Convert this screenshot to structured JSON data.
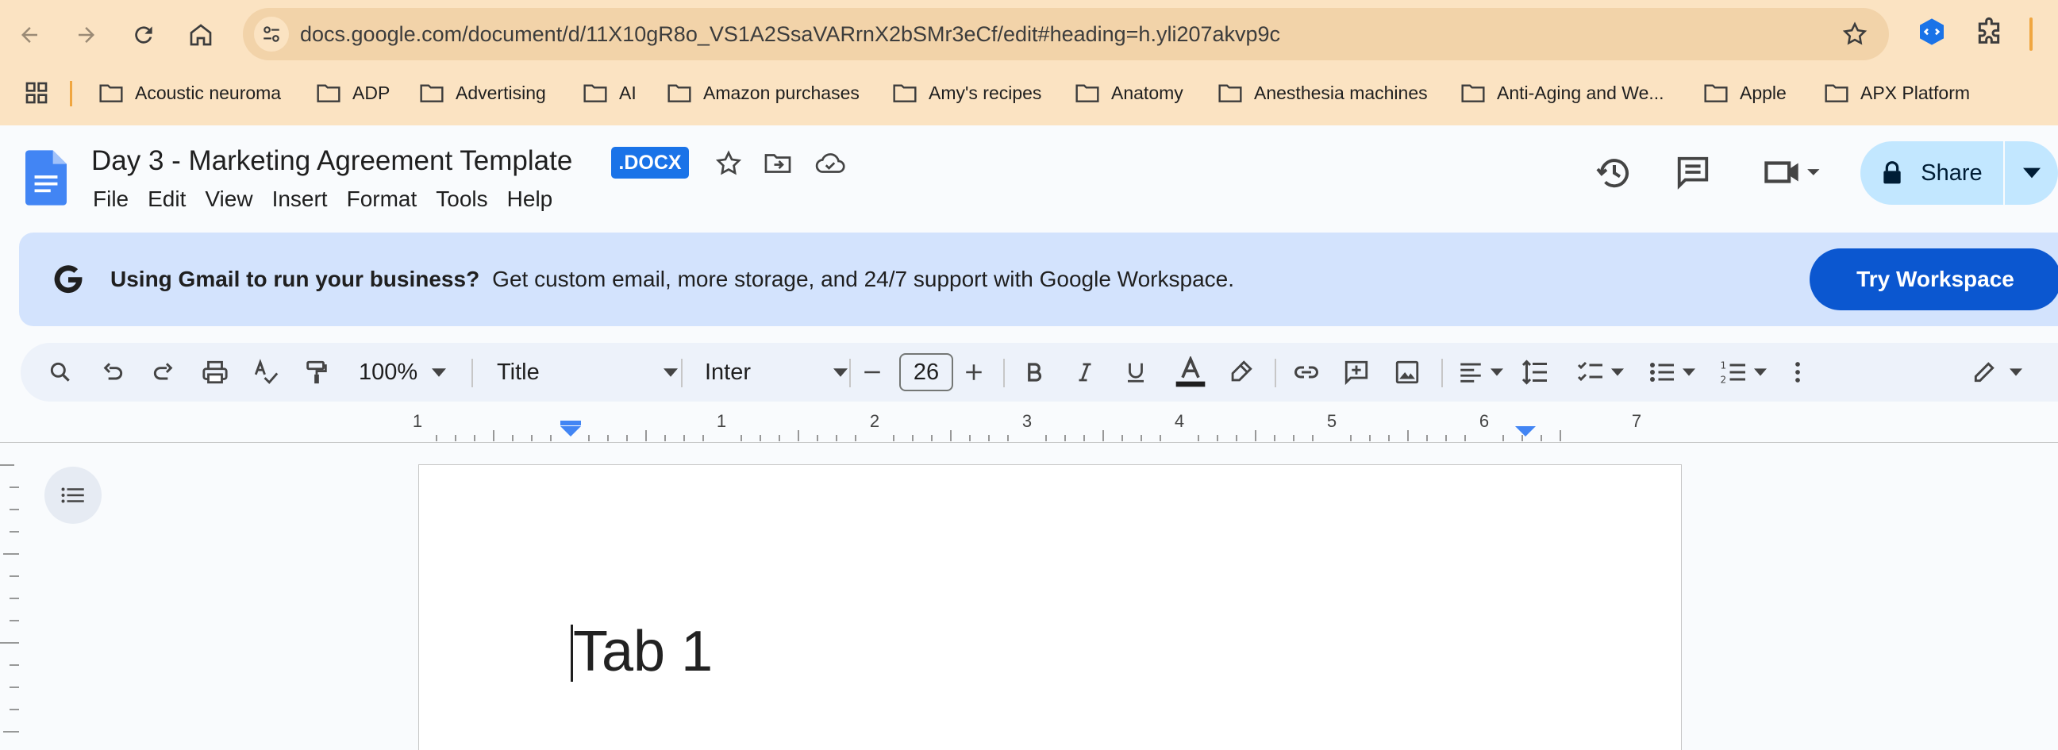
{
  "browser": {
    "url": "docs.google.com/document/d/11X10gR8o_VS1A2SsaVARrnX2bSMr3eCf/edit#heading=h.yli207akvp9c",
    "bookmarks": [
      "Acoustic neuroma",
      "ADP",
      "Advertising",
      "AI",
      "Amazon purchases",
      "Amy's recipes",
      "Anatomy",
      "Anesthesia machines",
      "Anti-Aging and We...",
      "Apple",
      "APX Platform"
    ],
    "accent_color": "#fbe3c2"
  },
  "doc": {
    "title": "Day 3 - Marketing Agreement Template",
    "badge": ".DOCX",
    "menus": [
      "File",
      "Edit",
      "View",
      "Insert",
      "Format",
      "Tools",
      "Help"
    ],
    "share_label": "Share"
  },
  "banner": {
    "headline": "Using Gmail to run your business?",
    "body": "Get custom email, more storage, and 24/7 support with Google Workspace.",
    "cta": "Try Workspace"
  },
  "toolbar": {
    "zoom": "100%",
    "style": "Title",
    "font": "Inter",
    "font_size": "26"
  },
  "ruler": {
    "labels": [
      "1",
      "1",
      "2",
      "3",
      "4",
      "5",
      "6",
      "7"
    ]
  },
  "page": {
    "heading": "Tab 1"
  }
}
